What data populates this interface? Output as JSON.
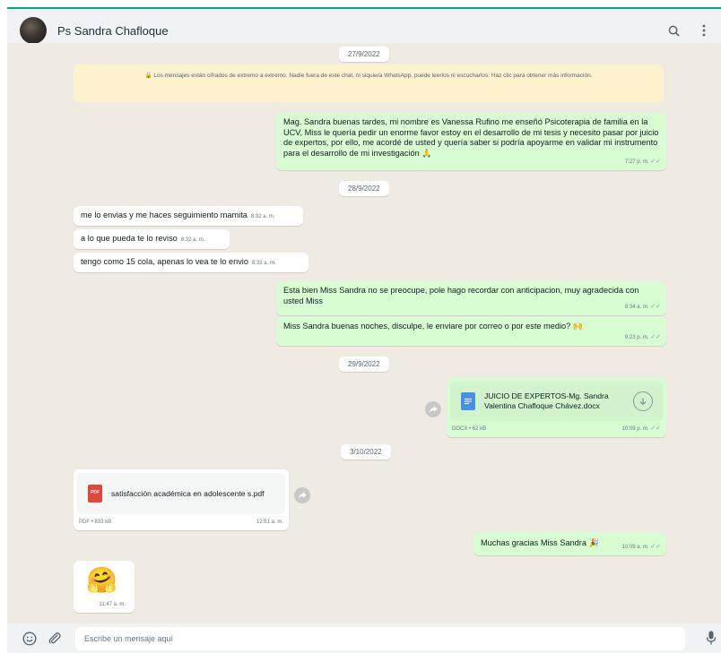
{
  "header": {
    "contact_name": "Ps Sandra Chafloque"
  },
  "encryption_notice": "🔒 Los mensajes están cifrados de extremo a extremo. Nadie fuera de este chat, ni siquiera WhatsApp, puede leerlos ni escucharlos. Haz clic para obtener más información.",
  "dates": [
    "27/9/2022",
    "28/9/2022",
    "29/9/2022",
    "3/10/2022"
  ],
  "messages": [
    {
      "text": "Mag. Sandra buenas tardes, mi nombre es Vanessa Rufino me enseñó  Psicoterapia de familia en la UCV, Miss le quería pedir un enorme favor estoy en el desarrollo de mi tesis y necesito pasar por juicio de expertos, por ello, me acordé de usted y quería saber si podría apoyarme en validar mi instrumento para el desarrollo de mi investigación 🙏",
      "time": "7:27 p. m."
    },
    {
      "text": "me lo envias y me haces seguimiento mamita",
      "time": "8:32 a. m."
    },
    {
      "text": "a lo que pueda te lo reviso",
      "time": "8:32 a. m."
    },
    {
      "text": "tengo como 15  cola, apenas lo vea te lo envio",
      "time": "8:33 a. m."
    },
    {
      "text": "Esta bien Miss Sandra no se preocupe, pole hago recordar con anticipacion, muy agradecida con usted Miss",
      "time": "8:34 a. m."
    },
    {
      "text": "Miss Sandra buenas noches, disculpe, le enviare por correo o por este medio? 🙌",
      "time": "9:23 p. m."
    },
    {
      "doc_name": "JUICIO DE EXPERTOS-Mg. Sandra Valentina Chafloque Chávez.docx",
      "meta": "DOCX • 62 kB",
      "time": "10:09 p. m."
    },
    {
      "doc_name": "satisfacción académica en adolescente s.pdf",
      "meta": "PDF • 833 kB",
      "time": "12:51 a. m.",
      "doc_icon_label": "PDF"
    },
    {
      "text": "Muchas gracias Miss Sandra 🎉",
      "time": "10:09 a. m."
    },
    {
      "emoji": "🤗",
      "time": "11:47 a. m."
    }
  ],
  "footer": {
    "placeholder": "Escribe un mensaje aquí"
  },
  "icons": [
    "search-icon",
    "menu-icon",
    "emoji-icon",
    "attach-icon",
    "mic-icon",
    "download-icon",
    "forward-icon",
    "lock-icon"
  ],
  "colors": {
    "header_bg": "#f0f2f5",
    "chat_bg": "#efeae2",
    "outgoing_bubble": "#d9fdd3",
    "incoming_bubble": "#ffffff",
    "accent": "#00a884",
    "notice_bg": "#fdf2cd"
  }
}
